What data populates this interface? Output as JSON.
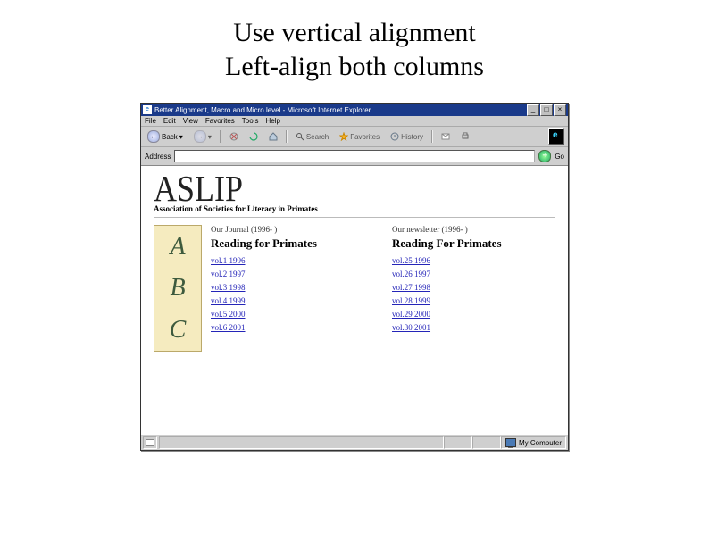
{
  "slide": {
    "title_line1": "Use vertical alignment",
    "title_line2": "Left-align both columns"
  },
  "browser": {
    "window_title": "Better Alignment, Macro and Micro level - Microsoft Internet Explorer",
    "menus": [
      "File",
      "Edit",
      "View",
      "Favorites",
      "Tools",
      "Help"
    ],
    "toolbar": {
      "back": "Back",
      "search": "Search",
      "favorites": "Favorites",
      "history": "History"
    },
    "address_label": "Address",
    "go_label": "Go",
    "status_right": "My Computer"
  },
  "page": {
    "logo": "ASLIP",
    "tagline": "Association of Societies for Literacy in Primates",
    "abc": [
      "A",
      "B",
      "C"
    ],
    "col1": {
      "caption": "Our Journal (1996- )",
      "heading": "Reading for Primates",
      "links": [
        "vol.1 1996",
        "vol.2 1997",
        "vol.3 1998",
        "vol.4 1999",
        "vol.5 2000",
        "vol.6 2001"
      ]
    },
    "col2": {
      "caption": "Our newsletter (1996- )",
      "heading": "Reading For Primates",
      "links": [
        "vol.25 1996",
        "vol.26 1997",
        "vol.27 1998",
        "vol.28 1999",
        "vol.29 2000",
        "vol.30 2001"
      ]
    }
  }
}
